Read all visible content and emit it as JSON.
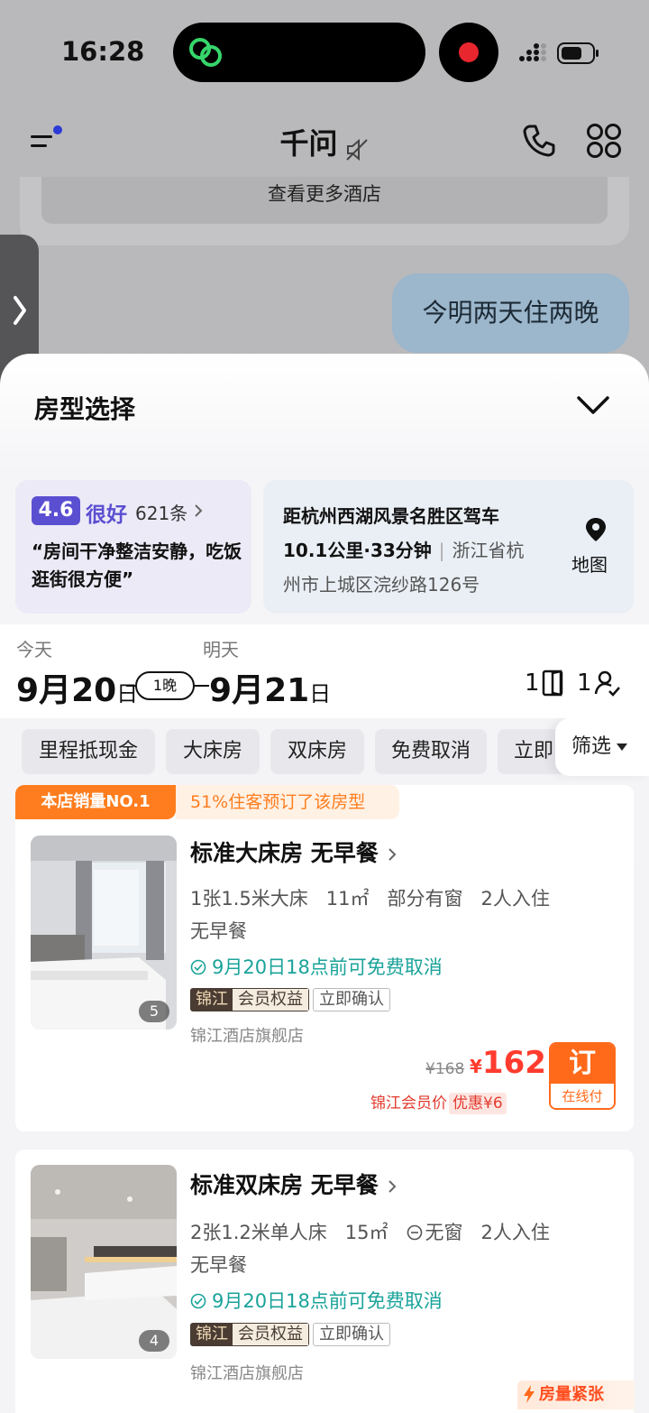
{
  "status_bar": {
    "time": "16:28"
  },
  "nav": {
    "title": "千问"
  },
  "chat": {
    "more_hotels_label": "查看更多酒店",
    "user_message": "今明两天住两晚"
  },
  "sheet": {
    "title": "房型选择",
    "rating": {
      "score": "4.6",
      "word": "很好",
      "count": "621条",
      "quote": "“房间干净整洁安静，吃饭逛街很方便”"
    },
    "location": {
      "line1": "距杭州西湖风景名胜区驾车",
      "distance": "10.1公里·33分钟",
      "address_part1": "浙江省杭",
      "address_part2": "州市上城区浣纱路126号",
      "map_label": "地图"
    },
    "dates": {
      "checkin_label": "今天",
      "checkout_label": "明天",
      "checkin_month": "9月",
      "checkin_day": "20",
      "checkout_month": "9月",
      "checkout_day": "21",
      "day_suffix": "日",
      "nights": "1晚",
      "rooms": "1",
      "guests": "1"
    },
    "filters": [
      "里程抵现金",
      "大床房",
      "双床房",
      "免费取消",
      "立即"
    ],
    "filter_button": "筛选",
    "rooms": [
      {
        "rank_tag": "本店销量NO.1",
        "rank_note": "51%住客预订了该房型",
        "name": "标准大床房 无早餐",
        "specs": [
          "1张1.5米大床",
          "11㎡",
          "部分有窗",
          "2人入住"
        ],
        "meal": "无早餐",
        "cancel": "9月20日18点前可免费取消",
        "badge_brand": "锦江",
        "badge_benefit": "会员权益",
        "badge_confirm": "立即确认",
        "shop": "锦江酒店旗舰店",
        "photo_count": "5",
        "price_old": "¥168",
        "price_currency": "¥",
        "price_new": "162",
        "member_label": "锦江会员价",
        "member_discount": "优惠¥6",
        "book_label": "订",
        "book_sub": "在线付"
      },
      {
        "name": "标准双床房 无早餐",
        "specs": [
          "2张1.2米单人床",
          "15㎡",
          "无窗",
          "2人入住"
        ],
        "meal": "无早餐",
        "cancel": "9月20日18点前可免费取消",
        "badge_brand": "锦江",
        "badge_benefit": "会员权益",
        "badge_confirm": "立即确认",
        "shop": "锦江酒店旗舰店",
        "photo_count": "4",
        "scarce_label": "房量紧张"
      }
    ]
  },
  "colors": {
    "accent_orange": "#ff7d1e",
    "price_red": "#ff3c2e",
    "rating_purple": "#5b4fd1",
    "cancel_green": "#1aa39a"
  }
}
